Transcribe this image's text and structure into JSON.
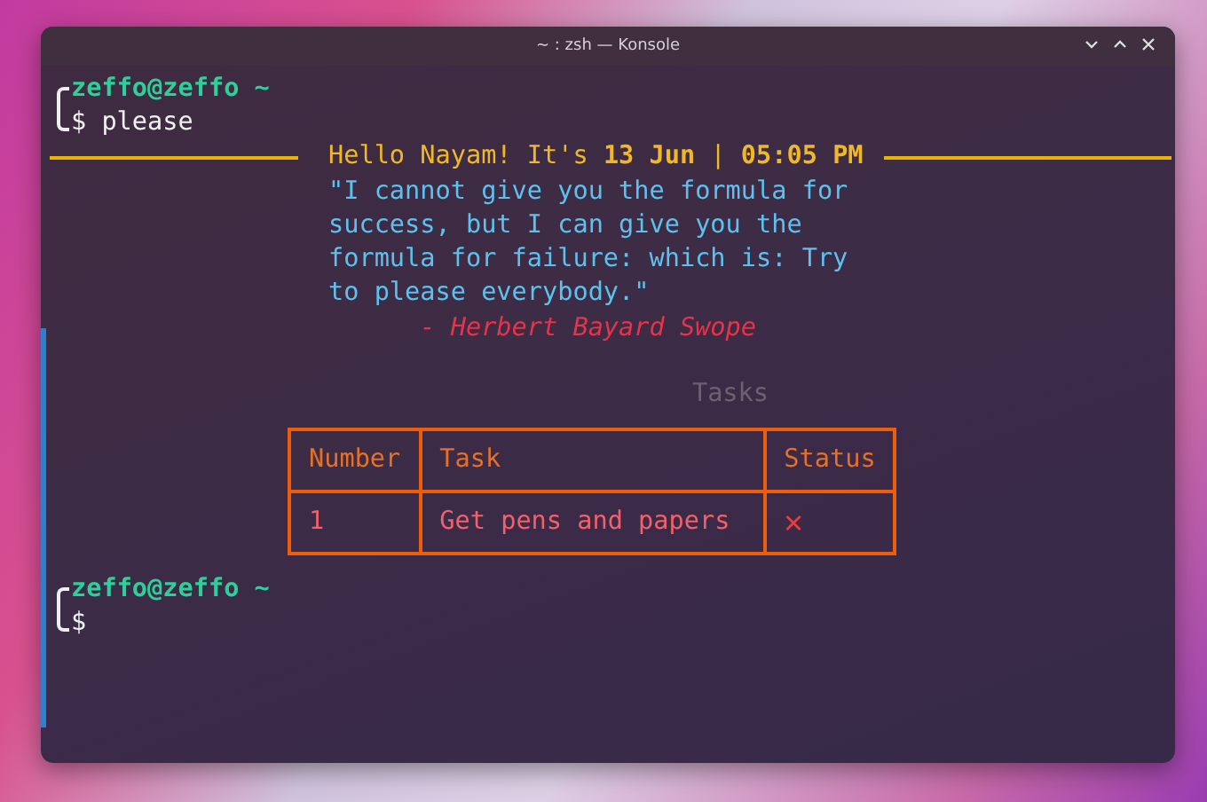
{
  "window": {
    "title": "~ : zsh — Konsole"
  },
  "prompts": [
    {
      "user": "zeffo@zeffo",
      "path": "~",
      "symbol": "$",
      "command": "please"
    }
  ],
  "greeting": "Hello Nayam! It's **13 Jun** | **05:05 PM**",
  "quote": {
    "text": "\"I cannot give you the formula for success, but I can give you the formula for failure: which is: Try to please everybody.\"",
    "author": "- Herbert Bayard Swope"
  },
  "tasks": {
    "title": "Tasks",
    "columns": [
      "Number",
      "Task",
      "Status"
    ],
    "rows": [
      {
        "cells": [
          "1",
          "Get pens and papers",
          "✕"
        ]
      }
    ]
  },
  "final_prompt": {
    "user": "zeffo@zeffo",
    "path": "~",
    "symbol": "$"
  }
}
